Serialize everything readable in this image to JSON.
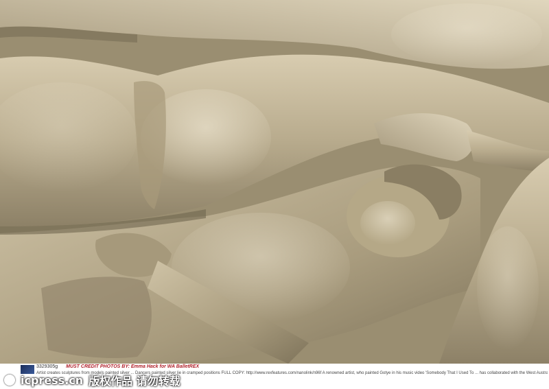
{
  "photo": {
    "alt": ""
  },
  "caption": {
    "id": "3329305g",
    "credit": "MUST CREDIT PHOTOS BY: Emma Hack for WA BalletREX",
    "body": "Artist creates sculptures from models painted silver ... Dancers painted silver lie in cramped positions FULL COPY: http://www.rexfeatures.com/nanolink/n96f   A renowned artist, who painted Gotye in his music video 'Somebody That I Used To ... has collaborated with the West Australian Ballet Company and its newly-appointed artistic director, Aurélien Scannella, to create silhouette sculp..."
  },
  "watermark": {
    "site": "icpress.cn",
    "notice": "版权作品 请勿转载"
  },
  "colors": {
    "credit": "#b0202a",
    "silver_light": "#d9ceb4",
    "silver_dark": "#6f654f"
  }
}
